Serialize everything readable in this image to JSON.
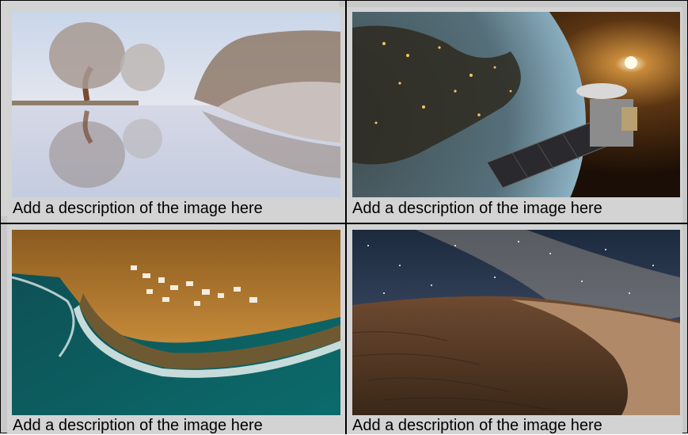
{
  "gallery": {
    "items": [
      {
        "caption": "Add a description of the image here",
        "image": "misty-trees-reflection-in-lake"
      },
      {
        "caption": "Add a description of the image here",
        "image": "satellite-orbiting-earth-at-night"
      },
      {
        "caption": "Add a description of the image here",
        "image": "aerial-coastal-village-by-cliffs"
      },
      {
        "caption": "Add a description of the image here",
        "image": "milky-way-over-desert-dunes"
      }
    ]
  }
}
